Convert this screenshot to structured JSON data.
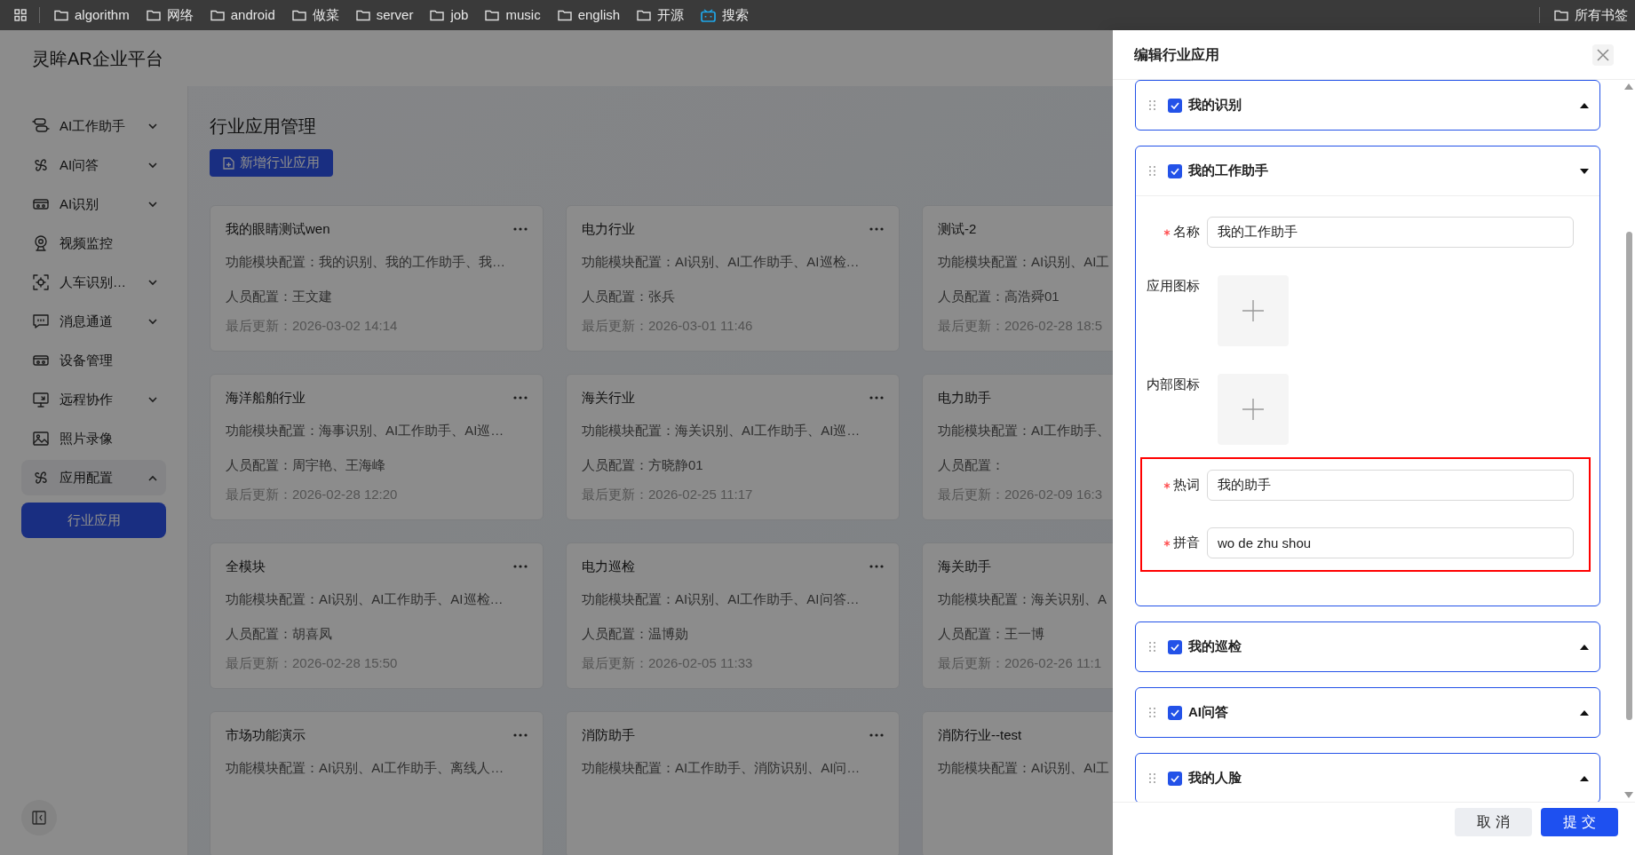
{
  "bookmarks": {
    "items": [
      {
        "label": "algorithm",
        "kind": "folder"
      },
      {
        "label": "网络",
        "kind": "folder"
      },
      {
        "label": "android",
        "kind": "folder"
      },
      {
        "label": "做菜",
        "kind": "folder"
      },
      {
        "label": "server",
        "kind": "folder"
      },
      {
        "label": "job",
        "kind": "folder"
      },
      {
        "label": "music",
        "kind": "folder"
      },
      {
        "label": "english",
        "kind": "folder"
      },
      {
        "label": "开源",
        "kind": "folder"
      },
      {
        "label": "搜索",
        "kind": "app"
      }
    ],
    "all": "所有书签"
  },
  "app_title": "灵眸AR企业平台",
  "sidebar": {
    "items": [
      {
        "label": "AI工作助手",
        "kind": "group",
        "expanded": false
      },
      {
        "label": "AI问答",
        "kind": "group",
        "expanded": false
      },
      {
        "label": "AI识别",
        "kind": "group",
        "expanded": false
      },
      {
        "label": "视频监控",
        "kind": "link"
      },
      {
        "label": "人车识别…",
        "kind": "group",
        "expanded": false
      },
      {
        "label": "消息通道",
        "kind": "group",
        "expanded": false
      },
      {
        "label": "设备管理",
        "kind": "link"
      },
      {
        "label": "远程协作",
        "kind": "group",
        "expanded": false
      },
      {
        "label": "照片录像",
        "kind": "link"
      },
      {
        "label": "应用配置",
        "kind": "group",
        "expanded": true,
        "children": [
          {
            "label": "行业应用",
            "selected": true
          }
        ]
      }
    ]
  },
  "main": {
    "title": "行业应用管理",
    "add_button": "新增行业应用",
    "cards": [
      {
        "title": "我的眼睛测试wen",
        "modules": "功能模块配置：我的识别、我的工作助手、我…",
        "staff": "人员配置：王文建",
        "updated": "最后更新：2026-03-02 14:14",
        "menu": true
      },
      {
        "title": "电力行业",
        "modules": "功能模块配置：AI识别、AI工作助手、AI巡检…",
        "staff": "人员配置：张兵",
        "updated": "最后更新：2026-03-01 11:46",
        "menu": true
      },
      {
        "title": "测试-2",
        "modules": "功能模块配置：AI识别、AI工",
        "staff": "人员配置：高浩舜01",
        "updated": "最后更新：2026-02-28 18:5",
        "menu": false
      },
      {
        "title": "海洋船舶行业",
        "modules": "功能模块配置：海事识别、AI工作助手、AI巡…",
        "staff": "人员配置：周宇艳、王海峰",
        "updated": "最后更新：2026-02-28 12:20",
        "menu": true
      },
      {
        "title": "海关行业",
        "modules": "功能模块配置：海关识别、AI工作助手、AI巡…",
        "staff": "人员配置：方晓静01",
        "updated": "最后更新：2026-02-25 11:17",
        "menu": true
      },
      {
        "title": "电力助手",
        "modules": "功能模块配置：AI工作助手、",
        "staff": "人员配置：",
        "updated": "最后更新：2026-02-09 16:3",
        "menu": false
      },
      {
        "title": "全模块",
        "modules": "功能模块配置：AI识别、AI工作助手、AI巡检…",
        "staff": "人员配置：胡喜凤",
        "updated": "最后更新：2026-02-28 15:50",
        "menu": true
      },
      {
        "title": "电力巡检",
        "modules": "功能模块配置：AI识别、AI工作助手、AI问答…",
        "staff": "人员配置：温博勋",
        "updated": "最后更新：2026-02-05 11:33",
        "menu": true
      },
      {
        "title": "海关助手",
        "modules": "功能模块配置：海关识别、A",
        "staff": "人员配置：王一博",
        "updated": "最后更新：2026-02-26 11:1",
        "menu": false
      },
      {
        "title": "市场功能演示",
        "modules": "功能模块配置：AI识别、AI工作助手、离线人…",
        "menu": true
      },
      {
        "title": "消防助手",
        "modules": "功能模块配置：AI工作助手、消防识别、AI问…",
        "menu": true
      },
      {
        "title": "消防行业--test",
        "modules": "功能模块配置：AI识别、AI工",
        "menu": false
      }
    ]
  },
  "drawer": {
    "title": "编辑行业应用",
    "modules": [
      {
        "label": "我的识别",
        "checked": true,
        "expanded": false
      },
      {
        "label": "我的工作助手",
        "checked": true,
        "expanded": true,
        "fields": [
          {
            "kind": "text",
            "label": "名称",
            "required": true,
            "value": "我的工作助手",
            "highlighted": false
          },
          {
            "kind": "upload",
            "label": "应用图标",
            "required": false,
            "highlighted": false
          },
          {
            "kind": "upload",
            "label": "内部图标",
            "required": false,
            "highlighted": false
          },
          {
            "kind": "text",
            "label": "热词",
            "required": true,
            "value": "我的助手",
            "highlighted": true
          },
          {
            "kind": "text",
            "label": "拼音",
            "required": true,
            "value": "wo de zhu shou",
            "highlighted": true
          }
        ]
      },
      {
        "label": "我的巡检",
        "checked": true,
        "expanded": false
      },
      {
        "label": "AI问答",
        "checked": true,
        "expanded": false
      },
      {
        "label": "我的人脸",
        "checked": true,
        "expanded": false
      }
    ],
    "buttons": [
      {
        "label": "取 消",
        "kind": "secondary"
      },
      {
        "label": "提 交",
        "kind": "primary"
      }
    ]
  }
}
